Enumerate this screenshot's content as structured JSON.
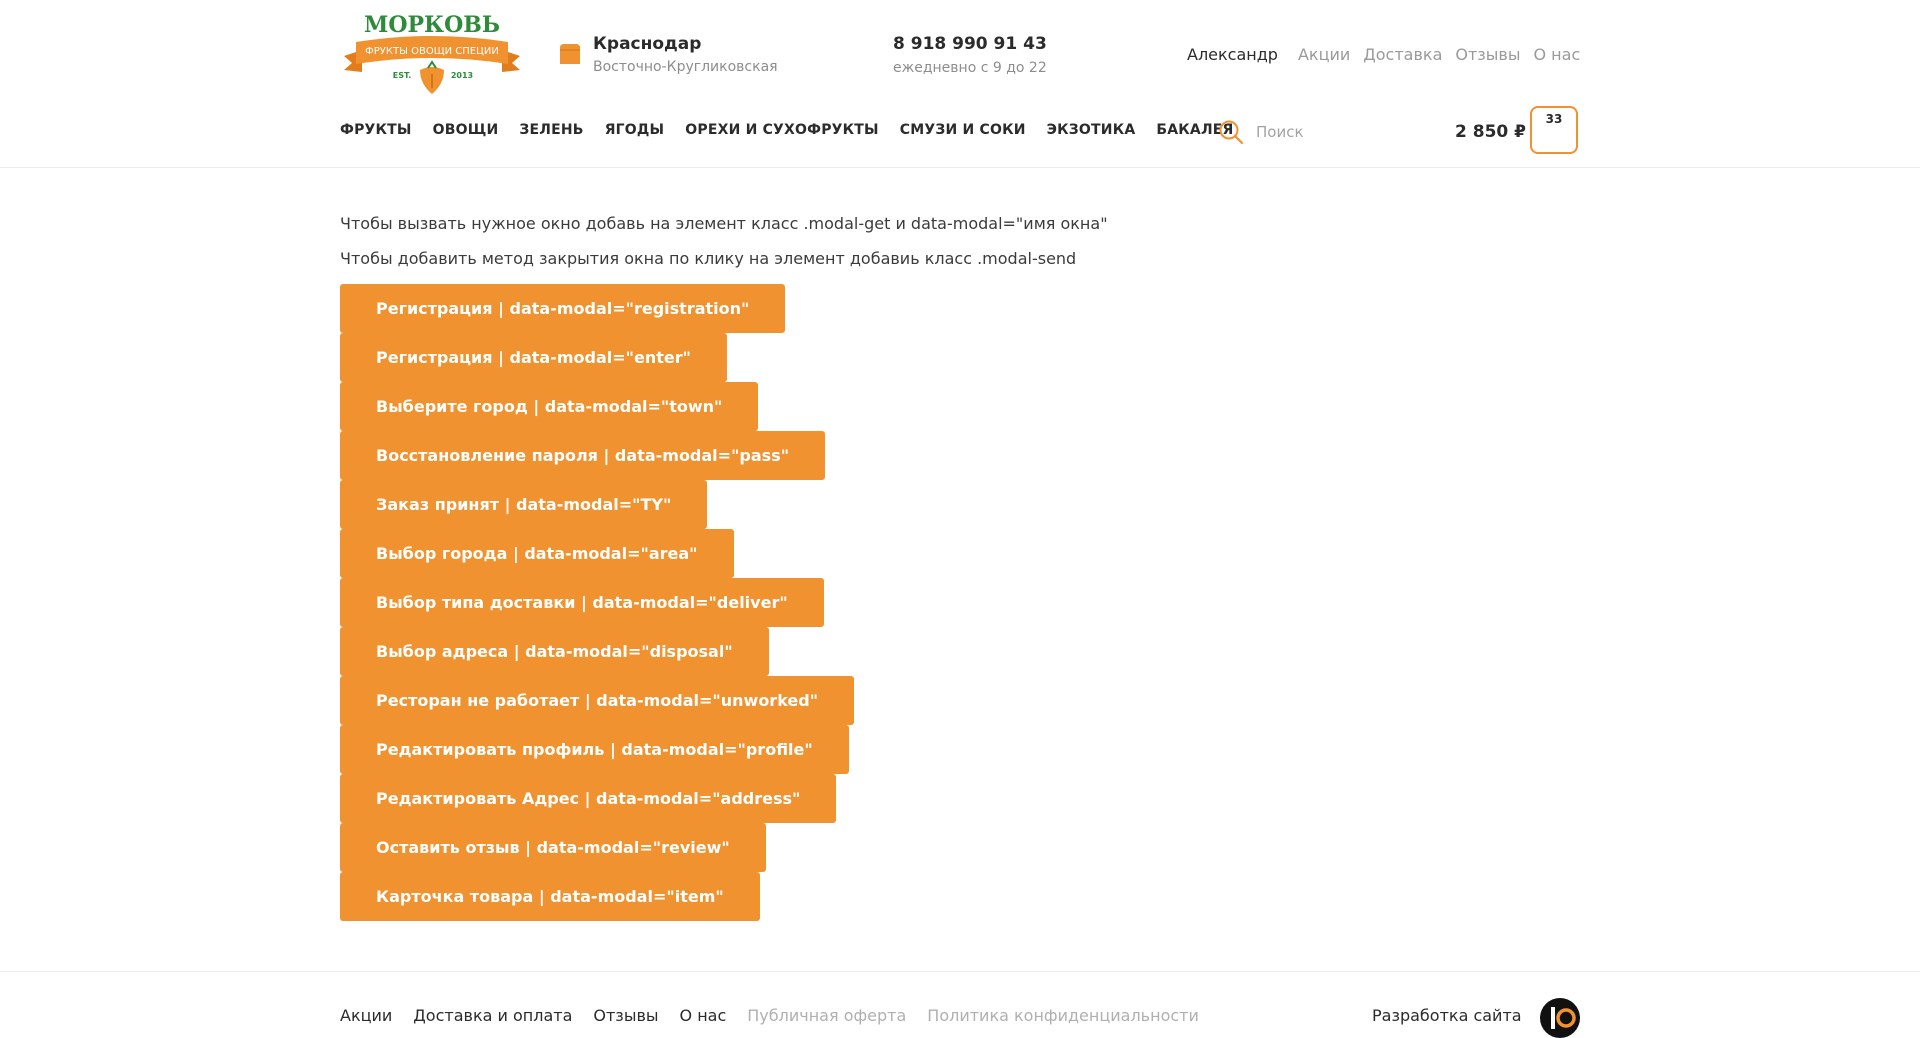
{
  "header": {
    "logo_text": "МОРКОВЬ",
    "logo_tagline": "ФРУКТЫ ОВОЩИ СПЕЦИИ",
    "logo_est": "EST.",
    "logo_year": "2013",
    "city": "Краснодар",
    "district": "Восточно-Кругликовская",
    "phone": "8 918 990 91 43",
    "hours": "ежедневно с 9 до 22",
    "user_name": "Александр",
    "links": [
      "Акции",
      "Доставка",
      "Отзывы",
      "О нас"
    ],
    "nav": [
      "ФРУКТЫ",
      "ОВОЩИ",
      "ЗЕЛЕНЬ",
      "ЯГОДЫ",
      "ОРЕХИ И СУХОФРУКТЫ",
      "СМУЗИ И СОКИ",
      "ЭКЗОТИКА",
      "БАКАЛЕЯ"
    ],
    "search_placeholder": "Поиск",
    "cart_total": "2 850 ₽",
    "cart_count": "33"
  },
  "main": {
    "info_1": "Чтобы вызвать нужное окно добавь на элемент класс .modal-get и data-modal=\"имя окна\"",
    "info_2": "Чтобы добавить метод закрытия окна по клику на элемент добавиь класс .modal-send",
    "buttons": [
      "Регистрация | data-modal=\"registration\"",
      "Регистрация | data-modal=\"enter\"",
      "Выберите город | data-modal=\"town\"",
      "Восстановление пароля | data-modal=\"pass\"",
      "Заказ принят | data-modal=\"TY\"",
      "Выбор города | data-modal=\"area\"",
      "Выбор типа доставки | data-modal=\"deliver\"",
      "Выбор адреса | data-modal=\"disposal\"",
      "Ресторан не работает | data-modal=\"unworked\"",
      "Редактировать профиль | data-modal=\"profile\"",
      "Редактировать Адрес | data-modal=\"address\"",
      "Оставить отзыв | data-modal=\"review\"",
      "Карточка товара | data-modal=\"item\""
    ]
  },
  "footer": {
    "links": [
      "Акции",
      "Доставка и оплата",
      "Отзывы",
      "О нас"
    ],
    "muted_links": [
      "Публичная оферта",
      "Политика конфиденциальности"
    ],
    "dev_text": "Разработка сайта"
  },
  "colors": {
    "accent": "#f0922f",
    "brand_green": "#2e8b3a",
    "text": "#2b2b2b",
    "muted": "#9a9a9a"
  }
}
